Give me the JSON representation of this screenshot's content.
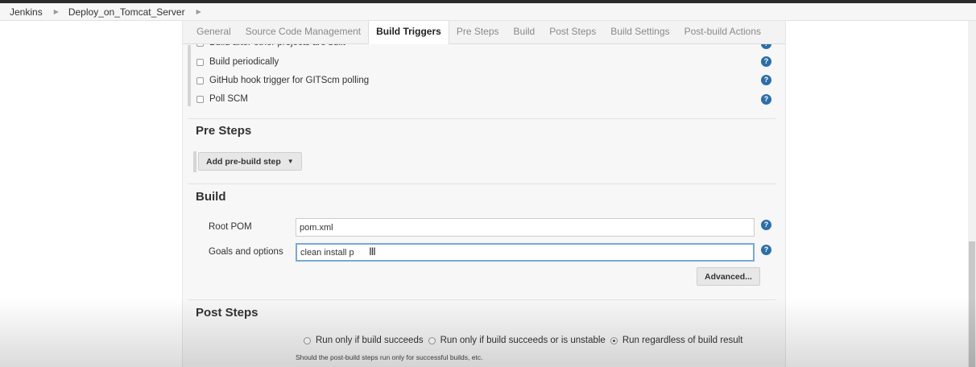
{
  "breadcrumb": {
    "items": [
      "Jenkins",
      "Deploy_on_Tomcat_Server"
    ]
  },
  "tabs": [
    "General",
    "Source Code Management",
    "Build Triggers",
    "Pre Steps",
    "Build",
    "Post Steps",
    "Build Settings",
    "Post-build Actions"
  ],
  "active_tab": "Build Triggers",
  "build_triggers": {
    "items": [
      "Build after other projects are built",
      "Build periodically",
      "GitHub hook trigger for GITScm polling",
      "Poll SCM"
    ]
  },
  "pre_steps": {
    "title": "Pre Steps",
    "add_button": "Add pre-build step"
  },
  "build": {
    "title": "Build",
    "root_pom_label": "Root POM",
    "root_pom_value": "pom.xml",
    "goals_label": "Goals and options",
    "goals_value": "clean install p",
    "advanced_button": "Advanced..."
  },
  "post_steps": {
    "title": "Post Steps",
    "options": [
      "Run only if build succeeds",
      "Run only if build succeeds or is unstable",
      "Run regardless of build result"
    ],
    "selected_index": 2,
    "hint": "Should the post-build steps run only for successful builds, etc."
  },
  "help_glyph": "?",
  "colors": {
    "help_icon": "#2d6ea9",
    "focus_border": "#7ba8d6"
  }
}
